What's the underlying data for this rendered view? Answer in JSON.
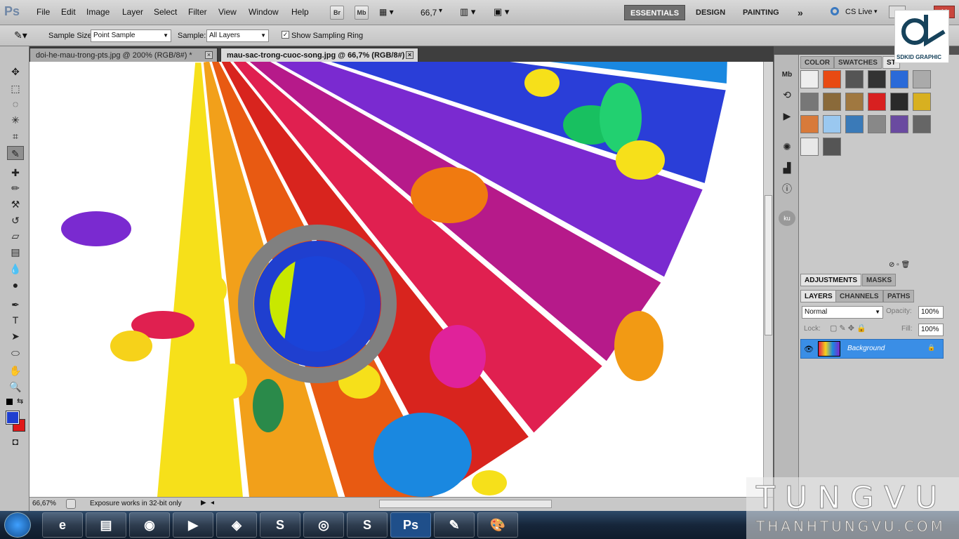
{
  "app": {
    "logo": "Ps"
  },
  "menu": [
    "File",
    "Edit",
    "Image",
    "Layer",
    "Select",
    "Filter",
    "View",
    "Window",
    "Help"
  ],
  "menubar_buttons": {
    "bridge": "Br",
    "minibridge": "Mb",
    "zoom": "66,7"
  },
  "workspaces": {
    "essentials": "ESSENTIALS",
    "design": "DESIGN",
    "painting": "PAINTING",
    "more": "»",
    "cslive": "CS Live"
  },
  "options": {
    "sample_size_label": "Sample Size:",
    "sample_size_value": "Point Sample",
    "sample_label": "Sample:",
    "sample_value": "All Layers",
    "show_ring_label": "Show Sampling Ring",
    "show_ring_checked": true
  },
  "tabs": [
    {
      "title": "doi-he-mau-trong-pts.jpg @ 200% (RGB/8#) *"
    },
    {
      "title": "mau-sac-trong-cuoc-song.jpg @ 66,7% (RGB/8#)"
    }
  ],
  "status": {
    "zoom": "66,67%",
    "message": "Exposure works in 32-bit only"
  },
  "panels": {
    "top_tabs": [
      "COLOR",
      "SWATCHES",
      "ST"
    ],
    "adjust_tabs": [
      "ADJUSTMENTS",
      "MASKS"
    ],
    "layer_tabs": [
      "LAYERS",
      "CHANNELS",
      "PATHS"
    ],
    "blend_mode": "Normal",
    "opacity_label": "Opacity:",
    "opacity_value": "100%",
    "lock_label": "Lock:",
    "fill_label": "Fill:",
    "fill_value": "100%",
    "layer_name": "Background"
  },
  "overlay": {
    "brand": "SDKID GRAPHIC",
    "watermark_top": "TUNGVU",
    "watermark_bottom": "THANHTUNGVU.COM"
  },
  "colors": {
    "foreground": "#1f3fcf",
    "background": "#e01818",
    "accent": "#3a8ee6"
  },
  "taskbar": {
    "apps": [
      "ie-icon",
      "explorer-icon",
      "firefox-icon",
      "media-icon",
      "game-icon",
      "sublime-icon",
      "chrome-icon",
      "skype-icon",
      "photoshop-icon",
      "notes-icon",
      "paint-icon"
    ],
    "ps_label": "Ps"
  }
}
